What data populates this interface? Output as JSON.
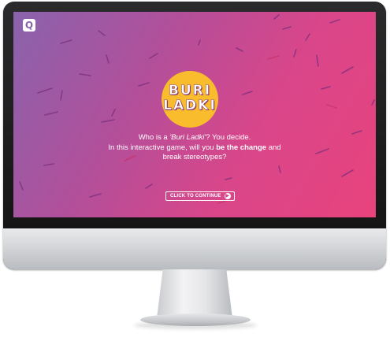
{
  "brand": {
    "logo_letter": "Q",
    "logo_icon": "quint-logo-icon"
  },
  "game": {
    "title_line_1": "BURI",
    "title_line_2": "LADKI",
    "intro_1_pre": "Who is a ",
    "intro_1_em": "'Buri Ladki'",
    "intro_1_post": "? You decide.",
    "intro_2_pre": "In this interactive game, will you ",
    "intro_2_bold": "be the change",
    "intro_2_post": " and",
    "intro_3": "break stereotypes?",
    "cta_label": "CLICK TO CONTINUE",
    "cta_icon": "arrow-right-circle-icon"
  },
  "colors": {
    "gradient_start": "#8a63ad",
    "gradient_end": "#e8437c",
    "badge": "#f9bc2d",
    "confetti": "#8c3a8a",
    "text": "#ffffff"
  }
}
